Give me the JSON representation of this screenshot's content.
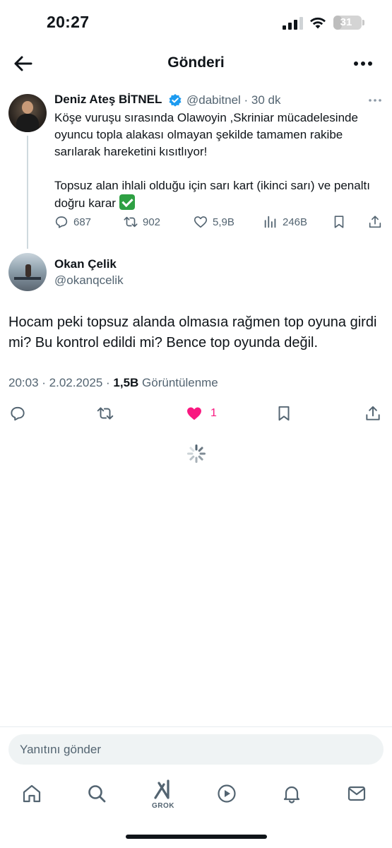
{
  "status_bar": {
    "time": "20:27",
    "battery": "31",
    "battery_level": 0.31
  },
  "header": {
    "title": "Gönderi",
    "back_icon": "arrow-left-icon",
    "more_icon": "more-horizontal-icon"
  },
  "parent_tweet": {
    "author_name": "Deniz Ateş BİTNEL",
    "handle_time": "@dabitnel · 30 dk",
    "text_main": "Köşe vuruşu sırasında Olawoyin ,Skriniar mücadelesinde oyuncu topla alakası olmayan şekilde tamamen rakibe sarılarak hareketini kısıtlıyor!\n\nTopsuz alan ihlali olduğu için sarı kart (ikinci sarı) ve penaltı doğru karar ",
    "emoji": "check-mark-emoji",
    "actions": {
      "replies": "687",
      "retweets": "902",
      "likes": "5,9B",
      "views": "246B"
    }
  },
  "main_tweet": {
    "author_name": "Okan Çelik",
    "handle": "@okanqcelik",
    "text": "Hocam peki topsuz alanda olmasıa rağmen top oyuna girdi mi? Bu kontrol edildi mi? Bence top oyunda değil.",
    "meta_time": "20:03 · 2.02.2025 · ",
    "meta_views": "1,5B",
    "meta_views_label": " Görüntülenme",
    "likes": "1",
    "liked_color": "#f91880"
  },
  "reply_box": {
    "placeholder": "Yanıtını gönder"
  },
  "tabbar": {
    "items": [
      {
        "icon": "home-icon"
      },
      {
        "icon": "search-icon"
      },
      {
        "icon": "grok-icon",
        "label": "GROK"
      },
      {
        "icon": "play-icon"
      },
      {
        "icon": "bell-icon"
      },
      {
        "icon": "mail-icon"
      }
    ]
  }
}
